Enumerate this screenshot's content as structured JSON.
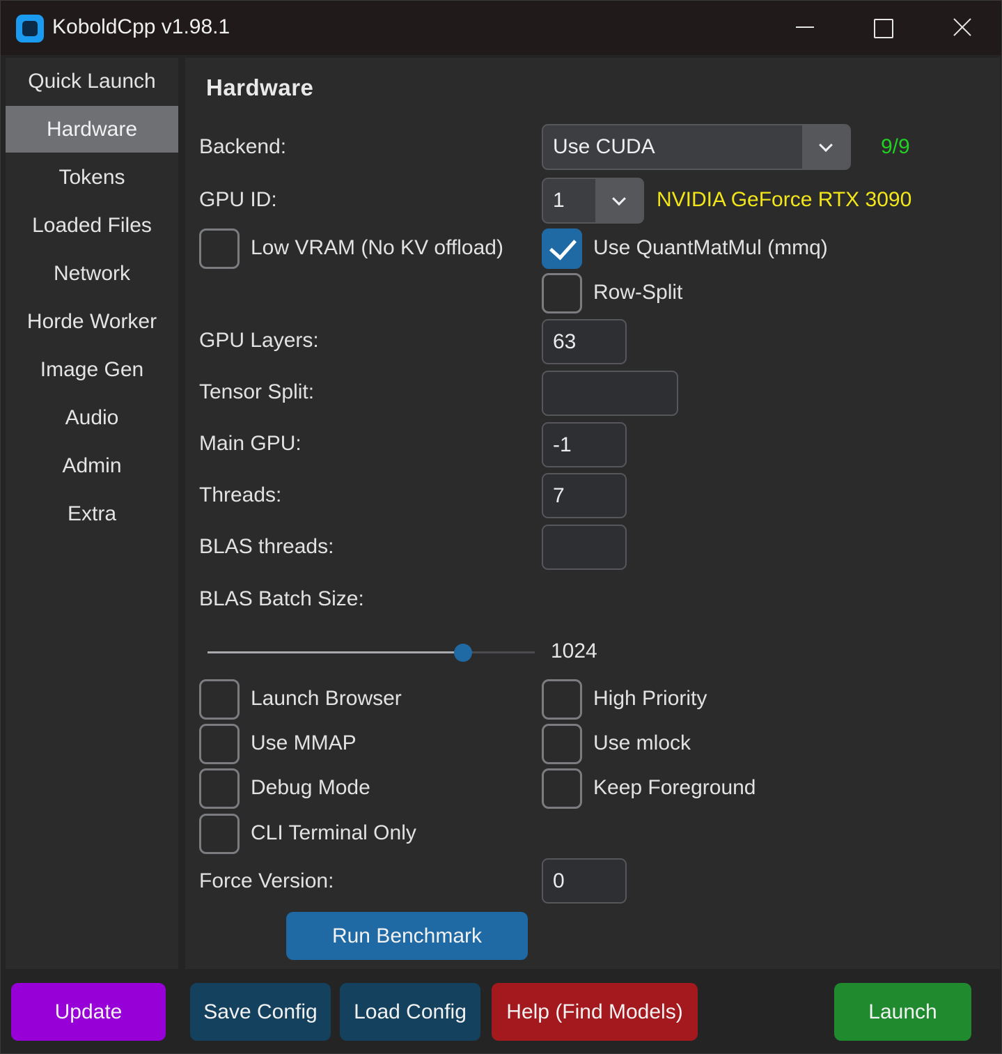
{
  "window": {
    "title": "KoboldCpp v1.98.1"
  },
  "sidebar": {
    "items": [
      {
        "label": "Quick Launch",
        "active": false
      },
      {
        "label": "Hardware",
        "active": true
      },
      {
        "label": "Tokens",
        "active": false
      },
      {
        "label": "Loaded Files",
        "active": false
      },
      {
        "label": "Network",
        "active": false
      },
      {
        "label": "Horde Worker",
        "active": false
      },
      {
        "label": "Image Gen",
        "active": false
      },
      {
        "label": "Audio",
        "active": false
      },
      {
        "label": "Admin",
        "active": false
      },
      {
        "label": "Extra",
        "active": false
      }
    ]
  },
  "hardware": {
    "heading": "Hardware",
    "backend_label": "Backend:",
    "backend_value": "Use CUDA",
    "backend_status": "9/9",
    "gpu_id_label": "GPU ID:",
    "gpu_id_value": "1",
    "gpu_name": "NVIDIA GeForce RTX 3090",
    "low_vram": {
      "label": "Low VRAM (No KV offload)",
      "checked": false
    },
    "use_mmq": {
      "label": "Use QuantMatMul (mmq)",
      "checked": true
    },
    "row_split": {
      "label": "Row-Split",
      "checked": false
    },
    "gpu_layers_label": "GPU Layers:",
    "gpu_layers_value": "63",
    "tensor_split_label": "Tensor Split:",
    "tensor_split_value": "",
    "main_gpu_label": "Main GPU:",
    "main_gpu_value": "-1",
    "threads_label": "Threads:",
    "threads_value": "7",
    "blas_threads_label": "BLAS threads:",
    "blas_threads_value": "",
    "blas_batch_label": "BLAS Batch Size:",
    "blas_batch_value": "1024",
    "blas_batch_slider_fraction": 0.78,
    "launch_browser": {
      "label": "Launch Browser",
      "checked": false
    },
    "high_priority": {
      "label": "High Priority",
      "checked": false
    },
    "use_mmap": {
      "label": "Use MMAP",
      "checked": false
    },
    "use_mlock": {
      "label": "Use mlock",
      "checked": false
    },
    "debug_mode": {
      "label": "Debug Mode",
      "checked": false
    },
    "keep_foreground": {
      "label": "Keep Foreground",
      "checked": false
    },
    "cli_terminal_only": {
      "label": "CLI Terminal Only",
      "checked": false
    },
    "force_version_label": "Force Version:",
    "force_version_value": "0",
    "run_benchmark": "Run Benchmark"
  },
  "footer": {
    "update": "Update",
    "save_config": "Save Config",
    "load_config": "Load Config",
    "help": "Help (Find Models)",
    "launch": "Launch"
  },
  "colors": {
    "accent": "#1f6aa5",
    "status_ok": "#22d022",
    "gpu_name": "#f2e61a",
    "update": "#9800d8",
    "config": "#14425e",
    "help": "#a4191e",
    "launch": "#1f8b2e"
  }
}
